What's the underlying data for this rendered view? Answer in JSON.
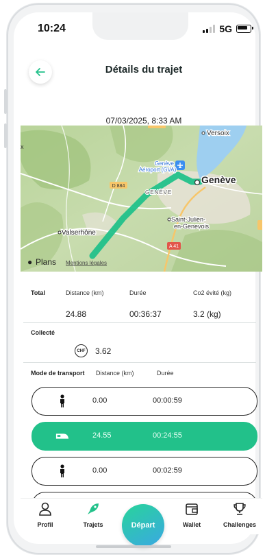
{
  "status_bar": {
    "time": "10:24",
    "network": "5G"
  },
  "header": {
    "title": "Détails du trajet"
  },
  "trip": {
    "datetime": "07/03/2025,  8:33 AM"
  },
  "map": {
    "labels": {
      "versoix": "Versoix",
      "airport": "Genève\nAéroport (GVA)",
      "geneve_city": "Genève",
      "geneve_area": "GENÈVE",
      "saint_julien": "Saint-Julien-\nen-Genevois",
      "valserhone": "Valserhône",
      "road_d884": "D 884",
      "road_a41": "A 41",
      "road_d884_top": "D 884"
    },
    "attribution": {
      "brand": "Plans",
      "legal": "Mentions légales"
    },
    "colors": {
      "route": "#22c18a",
      "water": "#9ecff0"
    }
  },
  "total": {
    "label": "Total",
    "distance_header": "Distance (km)",
    "duration_header": "Durée",
    "co2_header": "Co2 évité (kg)",
    "distance": "24.88",
    "duration": "00:36:37",
    "co2": "3.2 (kg)"
  },
  "collected": {
    "label": "Collecté",
    "currency_icon": "CHF",
    "amount": "3.62"
  },
  "transport": {
    "label": "Mode de transport",
    "distance_header": "Distance (km)",
    "duration_header": "Durée",
    "modes": [
      {
        "icon": "walking-icon",
        "distance": "0.00",
        "duration": "00:00:59",
        "active": false
      },
      {
        "icon": "train-icon",
        "distance": "24.55",
        "duration": "00:24:55",
        "active": true
      },
      {
        "icon": "walking-icon",
        "distance": "0.00",
        "duration": "00:02:59",
        "active": false
      }
    ]
  },
  "navbar": {
    "profil": "Profil",
    "trajets": "Trajets",
    "depart": "Départ",
    "wallet": "Wallet",
    "challenges": "Challenges"
  },
  "colors": {
    "accent": "#22c18a",
    "depart_gradient_end": "#3aa8e3"
  }
}
